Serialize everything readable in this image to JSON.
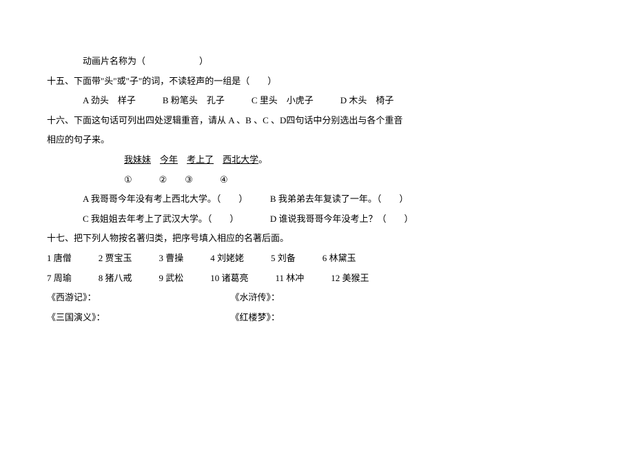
{
  "l1": "动画片名称为（　　　　　　）",
  "l2": "十五、下面带\"头\"或\"子\"的词，不读轻声的一组是（　　）",
  "l3": "A 劲头　样子　　　B 粉笔头　孔子　　　C 里头　小虎子　　　D 木头　椅子",
  "l4": "十六、下面这句话可列出四处逻辑重音，请从 A 、B 、C 、D四句话中分别选出与各个重音",
  "l5": "相应的句子来。",
  "l6a": "我妹妹",
  "l6b": "今年",
  "l6c": "考上了",
  "l6d": "西北大学",
  "l6e": "。",
  "l7": "①　　　②　　③　　　④",
  "l8": "A 我哥哥今年没有考上西北大学。（　　）　　　B 我弟弟去年复读了一年。（　　）",
  "l9": "C 我姐姐去年考上了武汉大学。（　　）　　　　D 谁说我哥哥今年没考上？（　　）",
  "l10": "十七、把下列人物按名著归类，把序号填入相应的名著后面。",
  "l11": "1 唐僧　　　2 贾宝玉　　　3 曹操　　　4 刘姥姥　　　5 刘备　　　6 林黛玉",
  "l12": "7 周瑜　　　8 猪八戒　　　9 武松　　　10 诸葛亮　　　11 林冲　　　12 美猴王",
  "l13": "《西游记》：　　　　　　　　　　　　　　　　《水浒传》：",
  "l14": "《三国演义》：　　　　　　　　　　　　　　　《红楼梦》："
}
